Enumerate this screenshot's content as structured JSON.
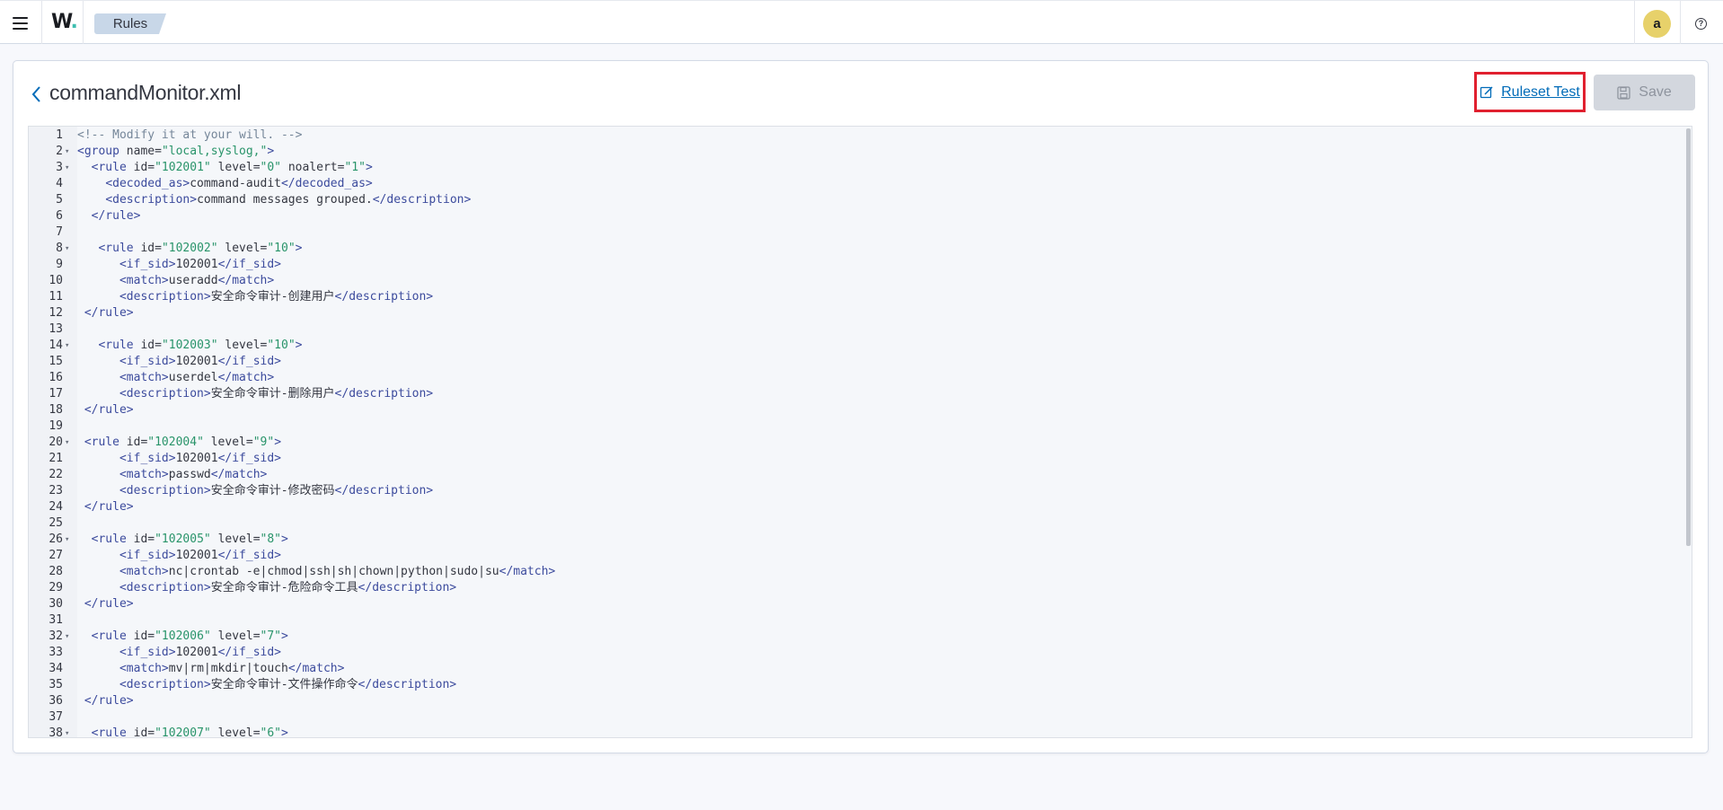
{
  "header": {
    "logo_text": "W",
    "logo_dot": ".",
    "breadcrumb": "Rules",
    "avatar_initial": "a",
    "help_glyph": "?"
  },
  "panel": {
    "file_title": "commandMonitor.xml",
    "ruleset_test_label": "Ruleset Test",
    "save_label": "Save"
  },
  "editor": {
    "lines": [
      {
        "n": "1",
        "fold": false,
        "html": "<span class=\"cmt\">&lt;!-- Modify it at your will. --&gt;</span>"
      },
      {
        "n": "2",
        "fold": true,
        "html": "<span class=\"tag\">&lt;group</span> <span class=\"attr\">name=</span><span class=\"str\">\"local,syslog,\"</span><span class=\"tag\">&gt;</span>"
      },
      {
        "n": "3",
        "fold": true,
        "html": "  <span class=\"tag\">&lt;rule</span> <span class=\"attr\">id=</span><span class=\"str\">\"102001\"</span> <span class=\"attr\">level=</span><span class=\"str\">\"0\"</span> <span class=\"attr\">noalert=</span><span class=\"str\">\"1\"</span><span class=\"tag\">&gt;</span>"
      },
      {
        "n": "4",
        "fold": false,
        "html": "    <span class=\"tag\">&lt;decoded_as&gt;</span>command-audit<span class=\"tag\">&lt;/decoded_as&gt;</span>"
      },
      {
        "n": "5",
        "fold": false,
        "html": "    <span class=\"tag\">&lt;description&gt;</span>command messages grouped.<span class=\"tag\">&lt;/description&gt;</span>"
      },
      {
        "n": "6",
        "fold": false,
        "html": "  <span class=\"tag\">&lt;/rule&gt;</span>"
      },
      {
        "n": "7",
        "fold": false,
        "html": ""
      },
      {
        "n": "8",
        "fold": true,
        "html": "   <span class=\"tag\">&lt;rule</span> <span class=\"attr\">id=</span><span class=\"str\">\"102002\"</span> <span class=\"attr\">level=</span><span class=\"str\">\"10\"</span><span class=\"tag\">&gt;</span>"
      },
      {
        "n": "9",
        "fold": false,
        "html": "      <span class=\"tag\">&lt;if_sid&gt;</span>102001<span class=\"tag\">&lt;/if_sid&gt;</span>"
      },
      {
        "n": "10",
        "fold": false,
        "html": "      <span class=\"tag\">&lt;match&gt;</span>useradd<span class=\"tag\">&lt;/match&gt;</span>"
      },
      {
        "n": "11",
        "fold": false,
        "html": "      <span class=\"tag\">&lt;description&gt;</span>安全命令审计-创建用户<span class=\"tag\">&lt;/description&gt;</span>"
      },
      {
        "n": "12",
        "fold": false,
        "html": " <span class=\"tag\">&lt;/rule&gt;</span>"
      },
      {
        "n": "13",
        "fold": false,
        "html": ""
      },
      {
        "n": "14",
        "fold": true,
        "html": "   <span class=\"tag\">&lt;rule</span> <span class=\"attr\">id=</span><span class=\"str\">\"102003\"</span> <span class=\"attr\">level=</span><span class=\"str\">\"10\"</span><span class=\"tag\">&gt;</span>"
      },
      {
        "n": "15",
        "fold": false,
        "html": "      <span class=\"tag\">&lt;if_sid&gt;</span>102001<span class=\"tag\">&lt;/if_sid&gt;</span>"
      },
      {
        "n": "16",
        "fold": false,
        "html": "      <span class=\"tag\">&lt;match&gt;</span>userdel<span class=\"tag\">&lt;/match&gt;</span>"
      },
      {
        "n": "17",
        "fold": false,
        "html": "      <span class=\"tag\">&lt;description&gt;</span>安全命令审计-删除用户<span class=\"tag\">&lt;/description&gt;</span>"
      },
      {
        "n": "18",
        "fold": false,
        "html": " <span class=\"tag\">&lt;/rule&gt;</span>"
      },
      {
        "n": "19",
        "fold": false,
        "html": ""
      },
      {
        "n": "20",
        "fold": true,
        "html": " <span class=\"tag\">&lt;rule</span> <span class=\"attr\">id=</span><span class=\"str\">\"102004\"</span> <span class=\"attr\">level=</span><span class=\"str\">\"9\"</span><span class=\"tag\">&gt;</span>"
      },
      {
        "n": "21",
        "fold": false,
        "html": "      <span class=\"tag\">&lt;if_sid&gt;</span>102001<span class=\"tag\">&lt;/if_sid&gt;</span>"
      },
      {
        "n": "22",
        "fold": false,
        "html": "      <span class=\"tag\">&lt;match&gt;</span>passwd<span class=\"tag\">&lt;/match&gt;</span>"
      },
      {
        "n": "23",
        "fold": false,
        "html": "      <span class=\"tag\">&lt;description&gt;</span>安全命令审计-修改密码<span class=\"tag\">&lt;/description&gt;</span>"
      },
      {
        "n": "24",
        "fold": false,
        "html": " <span class=\"tag\">&lt;/rule&gt;</span>"
      },
      {
        "n": "25",
        "fold": false,
        "html": ""
      },
      {
        "n": "26",
        "fold": true,
        "html": "  <span class=\"tag\">&lt;rule</span> <span class=\"attr\">id=</span><span class=\"str\">\"102005\"</span> <span class=\"attr\">level=</span><span class=\"str\">\"8\"</span><span class=\"tag\">&gt;</span>"
      },
      {
        "n": "27",
        "fold": false,
        "html": "      <span class=\"tag\">&lt;if_sid&gt;</span>102001<span class=\"tag\">&lt;/if_sid&gt;</span>"
      },
      {
        "n": "28",
        "fold": false,
        "html": "      <span class=\"tag\">&lt;match&gt;</span>nc|crontab -e|chmod|ssh|sh|chown|python|sudo|su<span class=\"tag\">&lt;/match&gt;</span>"
      },
      {
        "n": "29",
        "fold": false,
        "html": "      <span class=\"tag\">&lt;description&gt;</span>安全命令审计-危险命令工具<span class=\"tag\">&lt;/description&gt;</span>"
      },
      {
        "n": "30",
        "fold": false,
        "html": " <span class=\"tag\">&lt;/rule&gt;</span>"
      },
      {
        "n": "31",
        "fold": false,
        "html": ""
      },
      {
        "n": "32",
        "fold": true,
        "html": "  <span class=\"tag\">&lt;rule</span> <span class=\"attr\">id=</span><span class=\"str\">\"102006\"</span> <span class=\"attr\">level=</span><span class=\"str\">\"7\"</span><span class=\"tag\">&gt;</span>"
      },
      {
        "n": "33",
        "fold": false,
        "html": "      <span class=\"tag\">&lt;if_sid&gt;</span>102001<span class=\"tag\">&lt;/if_sid&gt;</span>"
      },
      {
        "n": "34",
        "fold": false,
        "html": "      <span class=\"tag\">&lt;match&gt;</span>mv|rm|mkdir|touch<span class=\"tag\">&lt;/match&gt;</span>"
      },
      {
        "n": "35",
        "fold": false,
        "html": "      <span class=\"tag\">&lt;description&gt;</span>安全命令审计-文件操作命令<span class=\"tag\">&lt;/description&gt;</span>"
      },
      {
        "n": "36",
        "fold": false,
        "html": " <span class=\"tag\">&lt;/rule&gt;</span>"
      },
      {
        "n": "37",
        "fold": false,
        "html": ""
      },
      {
        "n": "38",
        "fold": true,
        "html": "  <span class=\"tag\">&lt;rule</span> <span class=\"attr\">id=</span><span class=\"str\">\"102007\"</span> <span class=\"attr\">level=</span><span class=\"str\">\"6\"</span><span class=\"tag\">&gt;</span>"
      }
    ]
  }
}
